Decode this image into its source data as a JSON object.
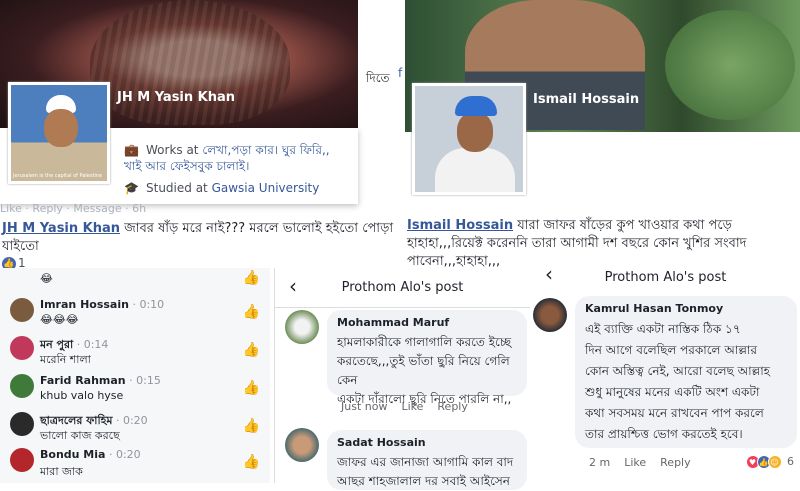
{
  "card1": {
    "name": "JH M Yasin Khan",
    "avatar_caption": "Jerusalem is the capital of Palestine",
    "works_prefix": "Works at ",
    "works_link": "লেখা,পড়া কার। ঘুর ফিরি,, খাই আর ফেইসবুক চালাই।",
    "studied_prefix": "Studied at ",
    "studied_link": "Gawsia University",
    "edge_text": "দিতে",
    "edge_link": "f",
    "faded_actions": "Like · Reply · Message · 6h"
  },
  "card2": {
    "name": "Ismail Hossain"
  },
  "comment_left": {
    "author": "JH M Yasin Khan",
    "text1": " জাবর ষাঁড় মরে নাই??? মরলে ভালোই হইতো পোড়া",
    "text2": "যাইতো",
    "like_count": "1"
  },
  "comment_right": {
    "author": "Ismail Hossain",
    "text1": " যারা জাফর ষাঁড়ের কুপ খাওয়ার কথা পড়ে",
    "text2": "হাহাহা,,,রিয়েক্ট করেননি তারা আগামী দশ বছরে কোন খুশির সংবাদ",
    "text3": "পাবেনা,,,হাহাহা,,,"
  },
  "left_list": [
    {
      "name": "",
      "time": "",
      "text": "😂"
    },
    {
      "name": "Imran Hossain",
      "time": " · 0:10",
      "text": "😂😂😂"
    },
    {
      "name": "মন পুরা",
      "time": " · 0:14",
      "text": "মরেনি শালা"
    },
    {
      "name": "Farid Rahman",
      "time": " · 0:15",
      "text": "khub valo hyse"
    },
    {
      "name": "ছাত্রদলের ফাহিম",
      "time": " · 0:20",
      "text": "ভালো কাজ করছে"
    },
    {
      "name": "Bondu Mia",
      "time": " · 0:20",
      "text": "মারা জাক"
    }
  ],
  "mob1": {
    "title": "Prothom Alo's post",
    "c1_name": "Mohammad Maruf",
    "c1_l1": "হামলাকারীকে গালাগালি করতে ইচ্ছে",
    "c1_l2": "করতেছে,,,তুই ভাঁতা ছুরি নিয়ে গেলি কেন",
    "c1_l3": "একটা দাঁরালো ছুরি নিতে পারলি না,,",
    "c1_time": "Just now",
    "like": "Like",
    "reply": "Reply",
    "c2_name": "Sadat Hossain",
    "c2_l1": "জাফর এর জানাজা আগামি কাল বাদ",
    "c2_l2": "আছর শাহজালাল দর সবাই আইসেন"
  },
  "mob2": {
    "title": "Prothom Alo's post",
    "name": "Kamrul Hasan Tonmoy",
    "l1": "এই ব্যাক্তি একটা নাস্তিক ঠিক ১৭",
    "l2": "দিন আগে বলেছিল পরকালে আল্লার",
    "l3": "কোন অস্তিত্ব নেই, আরো বলেছ আল্লাহ",
    "l4": "শুধু মানুষের মনের একটি অংশ একটা",
    "l5": "কথা সবসময় মনে রাখবেন পাপ করলে",
    "l6": "তার প্রায়শ্চিত্ত ভোগ করতেই হবে।",
    "time": "2 m",
    "like": "Like",
    "reply": "Reply",
    "reaction_count": "6"
  }
}
